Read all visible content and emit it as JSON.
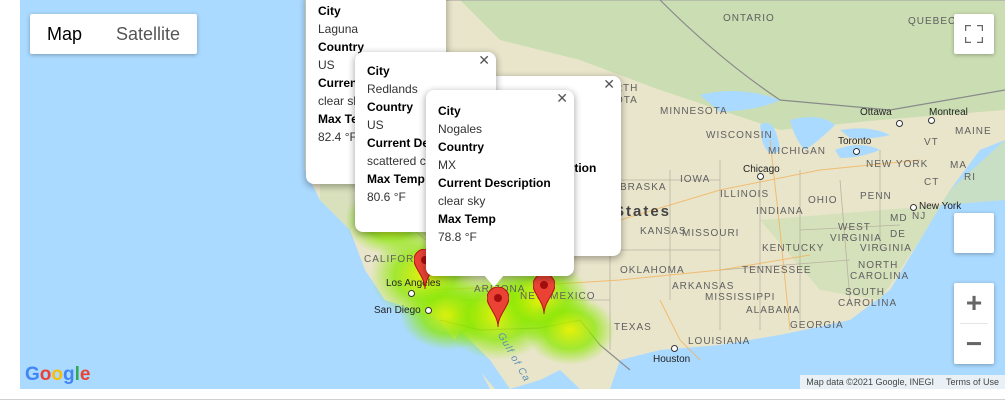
{
  "map_type": {
    "map": "Map",
    "satellite": "Satellite"
  },
  "controls": {
    "fullscreen_icon": "fullscreen-icon",
    "zoom_in": "+",
    "zoom_out": "−"
  },
  "labels": {
    "ontario": "ONTARIO",
    "quebec": "QUEBEC",
    "minnesota": "MINNESOTA",
    "wisconsin": "WISCONSIN",
    "michigan": "MICHIGAN",
    "iowa": "IOWA",
    "illinois": "ILLINOIS",
    "indiana": "INDIANA",
    "ohio": "OHIO",
    "penn": "PENN",
    "kansas": "KANSAS",
    "missouri": "MISSOURI",
    "kentucky": "KENTUCKY",
    "west_virginia": "WEST",
    "virginia": "VIRGINIA",
    "virginia2": "VIRGINIA",
    "oklahoma": "OKLAHOMA",
    "tennessee": "TENNESSEE",
    "north_carolina": "NORTH",
    "carolina": "CAROLINA",
    "south_carolina": "SOUTH",
    "carolina2": "CAROLINA",
    "arkansas": "ARKANSAS",
    "mississippi": "MISSISSIPPI",
    "alabama": "ALABAMA",
    "georgia": "GEORGIA",
    "texas": "TEXAS",
    "louisiana": "LOUISIANA",
    "arizona": "ARIZONA",
    "new_mexico": "NEW MEXICO",
    "california": "CALIFORNIA",
    "nebraska": "BRASKA",
    "north_frag": "RTH",
    "dakota_frag": "OTA",
    "md": "MD",
    "nj": "NJ",
    "vt": "VT",
    "maine": "MAINE",
    "ny": "NEW YORK",
    "ma": "MA",
    "ct": "CT",
    "de": "DE",
    "ri": "RI",
    "gulf": "Gulf of Ca"
  },
  "cities": {
    "ottawa": "Ottawa",
    "montreal": "Montreal",
    "toronto": "Toronto",
    "chicago": "Chicago",
    "new_york": "New York",
    "los_angeles": "Los Angeles",
    "san_diego": "San Diego",
    "houston": "Houston"
  },
  "country_label": "States",
  "info_windows": [
    {
      "city_label": "City",
      "city": "Laguna",
      "country_label": "Country",
      "country": "US",
      "desc_label": "Current Description",
      "desc": "clear sky",
      "temp_label": "Max Temp",
      "temp": "82.4 °F"
    },
    {
      "city_label": "City",
      "city": "Redlands",
      "country_label": "Country",
      "country": "US",
      "desc_label": "Current Description",
      "desc": "scattered clouds",
      "temp_label": "Max Temp",
      "temp": "80.6 °F"
    },
    {
      "city_label": "City",
      "city": "Nogales",
      "country_label": "Country",
      "country": "MX",
      "desc_label": "Current Description",
      "desc": "clear sky",
      "temp_label": "Max Temp",
      "temp": "78.8 °F"
    },
    {
      "desc_fragment": "ption",
      "desc_fragment2": "s"
    }
  ],
  "attribution": {
    "map_data": "Map data ©2021 Google, INEGI",
    "terms": "Terms of Use"
  },
  "google_logo": "Google",
  "colors": {
    "water": "#aadaff",
    "land": "#e8e6c9",
    "marker": "#ea4335",
    "heat_green": "#7ee000",
    "heat_yellow": "#e6f000"
  }
}
